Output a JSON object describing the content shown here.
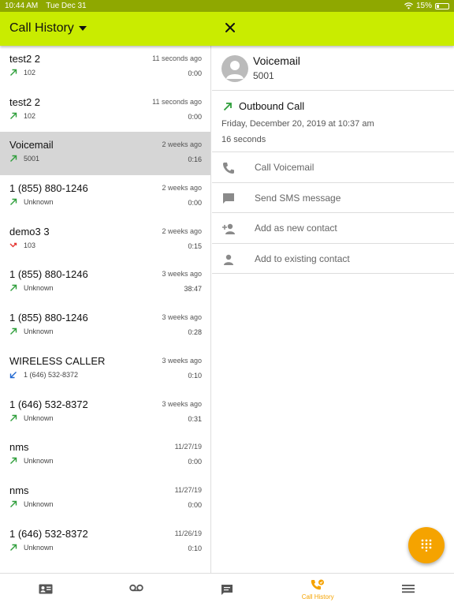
{
  "status_bar": {
    "time": "10:44 AM",
    "date": "Tue Dec 31",
    "battery": "15%"
  },
  "header": {
    "title": "Call History"
  },
  "colors": {
    "accent": "#c9ec00",
    "outbound": "#2e9e3a",
    "missed": "#e53935",
    "inbound": "#1e66d0",
    "fab": "#f5a300"
  },
  "calls": [
    {
      "name": "test2 2",
      "when": "11 seconds ago",
      "number": "102",
      "duration": "0:00",
      "type": "outbound"
    },
    {
      "name": "test2 2",
      "when": "11 seconds ago",
      "number": "102",
      "duration": "0:00",
      "type": "outbound"
    },
    {
      "name": "Voicemail",
      "when": "2 weeks ago",
      "number": "5001",
      "duration": "0:16",
      "type": "outbound"
    },
    {
      "name": "1 (855) 880-1246",
      "when": "2 weeks ago",
      "number": "Unknown",
      "duration": "0:00",
      "type": "outbound"
    },
    {
      "name": "demo3 3",
      "when": "2 weeks ago",
      "number": "103",
      "duration": "0:15",
      "type": "missed"
    },
    {
      "name": "1 (855) 880-1246",
      "when": "3 weeks ago",
      "number": "Unknown",
      "duration": "38:47",
      "type": "outbound"
    },
    {
      "name": "1 (855) 880-1246",
      "when": "3 weeks ago",
      "number": "Unknown",
      "duration": "0:28",
      "type": "outbound"
    },
    {
      "name": "WIRELESS CALLER",
      "when": "3 weeks ago",
      "number": "1 (646) 532-8372",
      "duration": "0:10",
      "type": "inbound"
    },
    {
      "name": "1 (646) 532-8372",
      "when": "3 weeks ago",
      "number": "Unknown",
      "duration": "0:31",
      "type": "outbound"
    },
    {
      "name": "nms",
      "when": "11/27/19",
      "number": "Unknown",
      "duration": "0:00",
      "type": "outbound"
    },
    {
      "name": "nms",
      "when": "11/27/19",
      "number": "Unknown",
      "duration": "0:00",
      "type": "outbound"
    },
    {
      "name": "1 (646) 532-8372",
      "when": "11/26/19",
      "number": "Unknown",
      "duration": "0:10",
      "type": "outbound"
    }
  ],
  "detail": {
    "name": "Voicemail",
    "number": "5001",
    "call_type": "Outbound Call",
    "date": "Friday, December 20, 2019 at 10:37 am",
    "duration": "16 seconds",
    "actions": [
      {
        "label": "Call Voicemail",
        "icon": "phone-icon"
      },
      {
        "label": "Send SMS message",
        "icon": "message-icon"
      },
      {
        "label": "Add as new contact",
        "icon": "add-person-icon"
      },
      {
        "label": "Add to existing contact",
        "icon": "person-icon"
      }
    ]
  },
  "tabs": [
    {
      "icon": "contacts-icon",
      "label": "",
      "active": false
    },
    {
      "icon": "voicemail-icon",
      "label": "",
      "active": false
    },
    {
      "icon": "chat-icon",
      "label": "",
      "active": false
    },
    {
      "icon": "call-history-icon",
      "label": "Call History",
      "active": true
    },
    {
      "icon": "menu-icon",
      "label": "",
      "active": false
    }
  ]
}
